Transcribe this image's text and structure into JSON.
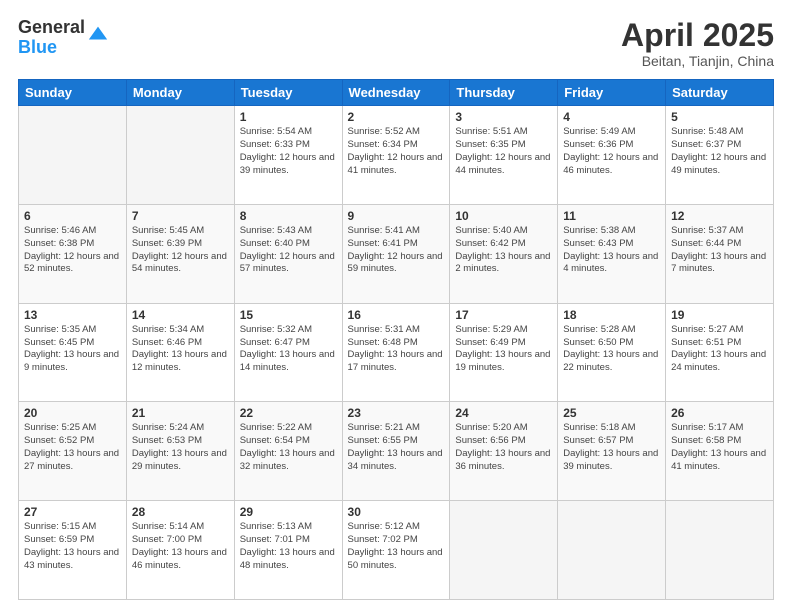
{
  "header": {
    "logo_general": "General",
    "logo_blue": "Blue",
    "month_year": "April 2025",
    "location": "Beitan, Tianjin, China"
  },
  "weekdays": [
    "Sunday",
    "Monday",
    "Tuesday",
    "Wednesday",
    "Thursday",
    "Friday",
    "Saturday"
  ],
  "rows": [
    [
      {
        "day": "",
        "info": ""
      },
      {
        "day": "",
        "info": ""
      },
      {
        "day": "1",
        "info": "Sunrise: 5:54 AM\nSunset: 6:33 PM\nDaylight: 12 hours and 39 minutes."
      },
      {
        "day": "2",
        "info": "Sunrise: 5:52 AM\nSunset: 6:34 PM\nDaylight: 12 hours and 41 minutes."
      },
      {
        "day": "3",
        "info": "Sunrise: 5:51 AM\nSunset: 6:35 PM\nDaylight: 12 hours and 44 minutes."
      },
      {
        "day": "4",
        "info": "Sunrise: 5:49 AM\nSunset: 6:36 PM\nDaylight: 12 hours and 46 minutes."
      },
      {
        "day": "5",
        "info": "Sunrise: 5:48 AM\nSunset: 6:37 PM\nDaylight: 12 hours and 49 minutes."
      }
    ],
    [
      {
        "day": "6",
        "info": "Sunrise: 5:46 AM\nSunset: 6:38 PM\nDaylight: 12 hours and 52 minutes."
      },
      {
        "day": "7",
        "info": "Sunrise: 5:45 AM\nSunset: 6:39 PM\nDaylight: 12 hours and 54 minutes."
      },
      {
        "day": "8",
        "info": "Sunrise: 5:43 AM\nSunset: 6:40 PM\nDaylight: 12 hours and 57 minutes."
      },
      {
        "day": "9",
        "info": "Sunrise: 5:41 AM\nSunset: 6:41 PM\nDaylight: 12 hours and 59 minutes."
      },
      {
        "day": "10",
        "info": "Sunrise: 5:40 AM\nSunset: 6:42 PM\nDaylight: 13 hours and 2 minutes."
      },
      {
        "day": "11",
        "info": "Sunrise: 5:38 AM\nSunset: 6:43 PM\nDaylight: 13 hours and 4 minutes."
      },
      {
        "day": "12",
        "info": "Sunrise: 5:37 AM\nSunset: 6:44 PM\nDaylight: 13 hours and 7 minutes."
      }
    ],
    [
      {
        "day": "13",
        "info": "Sunrise: 5:35 AM\nSunset: 6:45 PM\nDaylight: 13 hours and 9 minutes."
      },
      {
        "day": "14",
        "info": "Sunrise: 5:34 AM\nSunset: 6:46 PM\nDaylight: 13 hours and 12 minutes."
      },
      {
        "day": "15",
        "info": "Sunrise: 5:32 AM\nSunset: 6:47 PM\nDaylight: 13 hours and 14 minutes."
      },
      {
        "day": "16",
        "info": "Sunrise: 5:31 AM\nSunset: 6:48 PM\nDaylight: 13 hours and 17 minutes."
      },
      {
        "day": "17",
        "info": "Sunrise: 5:29 AM\nSunset: 6:49 PM\nDaylight: 13 hours and 19 minutes."
      },
      {
        "day": "18",
        "info": "Sunrise: 5:28 AM\nSunset: 6:50 PM\nDaylight: 13 hours and 22 minutes."
      },
      {
        "day": "19",
        "info": "Sunrise: 5:27 AM\nSunset: 6:51 PM\nDaylight: 13 hours and 24 minutes."
      }
    ],
    [
      {
        "day": "20",
        "info": "Sunrise: 5:25 AM\nSunset: 6:52 PM\nDaylight: 13 hours and 27 minutes."
      },
      {
        "day": "21",
        "info": "Sunrise: 5:24 AM\nSunset: 6:53 PM\nDaylight: 13 hours and 29 minutes."
      },
      {
        "day": "22",
        "info": "Sunrise: 5:22 AM\nSunset: 6:54 PM\nDaylight: 13 hours and 32 minutes."
      },
      {
        "day": "23",
        "info": "Sunrise: 5:21 AM\nSunset: 6:55 PM\nDaylight: 13 hours and 34 minutes."
      },
      {
        "day": "24",
        "info": "Sunrise: 5:20 AM\nSunset: 6:56 PM\nDaylight: 13 hours and 36 minutes."
      },
      {
        "day": "25",
        "info": "Sunrise: 5:18 AM\nSunset: 6:57 PM\nDaylight: 13 hours and 39 minutes."
      },
      {
        "day": "26",
        "info": "Sunrise: 5:17 AM\nSunset: 6:58 PM\nDaylight: 13 hours and 41 minutes."
      }
    ],
    [
      {
        "day": "27",
        "info": "Sunrise: 5:15 AM\nSunset: 6:59 PM\nDaylight: 13 hours and 43 minutes."
      },
      {
        "day": "28",
        "info": "Sunrise: 5:14 AM\nSunset: 7:00 PM\nDaylight: 13 hours and 46 minutes."
      },
      {
        "day": "29",
        "info": "Sunrise: 5:13 AM\nSunset: 7:01 PM\nDaylight: 13 hours and 48 minutes."
      },
      {
        "day": "30",
        "info": "Sunrise: 5:12 AM\nSunset: 7:02 PM\nDaylight: 13 hours and 50 minutes."
      },
      {
        "day": "",
        "info": ""
      },
      {
        "day": "",
        "info": ""
      },
      {
        "day": "",
        "info": ""
      }
    ]
  ]
}
